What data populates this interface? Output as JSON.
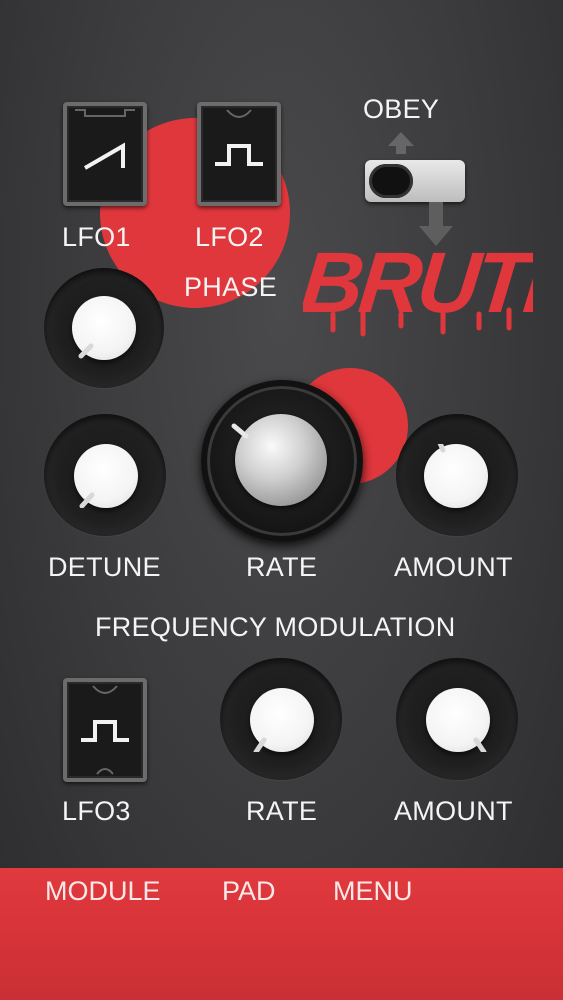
{
  "switches": {
    "lfo1": {
      "label": "LFO1",
      "waveform": "saw-wave-icon"
    },
    "lfo2": {
      "label": "LFO2",
      "waveform": "square-wave-icon"
    },
    "lfo3": {
      "label": "LFO3",
      "waveform": "square-wave-icon"
    }
  },
  "obey": {
    "label": "OBEY"
  },
  "labels": {
    "phase": "PHASE",
    "detune": "DETUNE",
    "rate": "RATE",
    "amount": "AMOUNT",
    "frequency_modulation": "FREQUENCY MODULATION",
    "fm_rate": "RATE",
    "fm_amount": "AMOUNT"
  },
  "logo": {
    "text": "BRUTE"
  },
  "tabs": [
    {
      "label": "MODULE"
    },
    {
      "label": "PAD"
    },
    {
      "label": "MENU"
    }
  ],
  "colors": {
    "accent_red": "#e0373c",
    "background": "#3a3a3c",
    "bottom_bar": "#d93439"
  }
}
